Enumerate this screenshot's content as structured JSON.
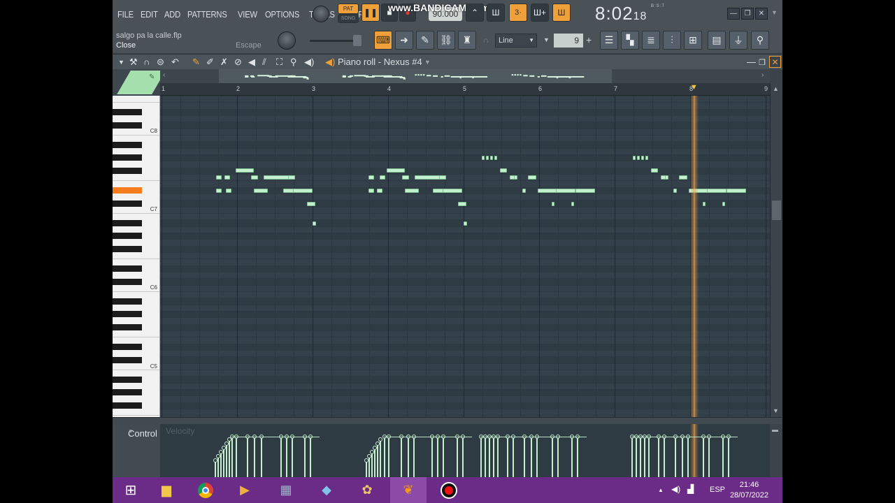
{
  "menu": [
    "FILE",
    "EDIT",
    "ADD",
    "PATTERNS",
    "VIEW",
    "OPTIONS",
    "TOOLS",
    "HELP"
  ],
  "transport": {
    "pat_label": "PAT",
    "song_label": "SONG",
    "bpm": "90.000"
  },
  "watermark": "www.BANDICAM.com",
  "clock": {
    "main": "8:02",
    "sub": "18",
    "unit": "B:S:T"
  },
  "hint": {
    "file": "salgo pa la calle.flp",
    "action": "Close",
    "shortcut": "Escape"
  },
  "toolbar2": {
    "snap": "Line",
    "snap_value": "9"
  },
  "piano_roll": {
    "title": "Piano roll - Nexus #4"
  },
  "ruler": {
    "bars": [
      "1",
      "2",
      "3",
      "4",
      "5",
      "6",
      "7",
      "8",
      "9"
    ]
  },
  "keyboard": {
    "octaves": [
      "C8",
      "C7",
      "C6",
      "C5"
    ]
  },
  "control": {
    "label": "Control",
    "parameter": "Velocity"
  },
  "taskbar": {
    "apps": [
      "windows-start",
      "file-explorer",
      "chrome",
      "media-player",
      "calculator",
      "notepad",
      "paint",
      "fl-studio",
      "bandicam"
    ],
    "lang": "ESP",
    "time": "21:46",
    "date": "28/07/2022"
  },
  "colors": {
    "accent": "#f0a03a",
    "note": "#c3f0cf",
    "taskbar": "#6a2c86"
  }
}
